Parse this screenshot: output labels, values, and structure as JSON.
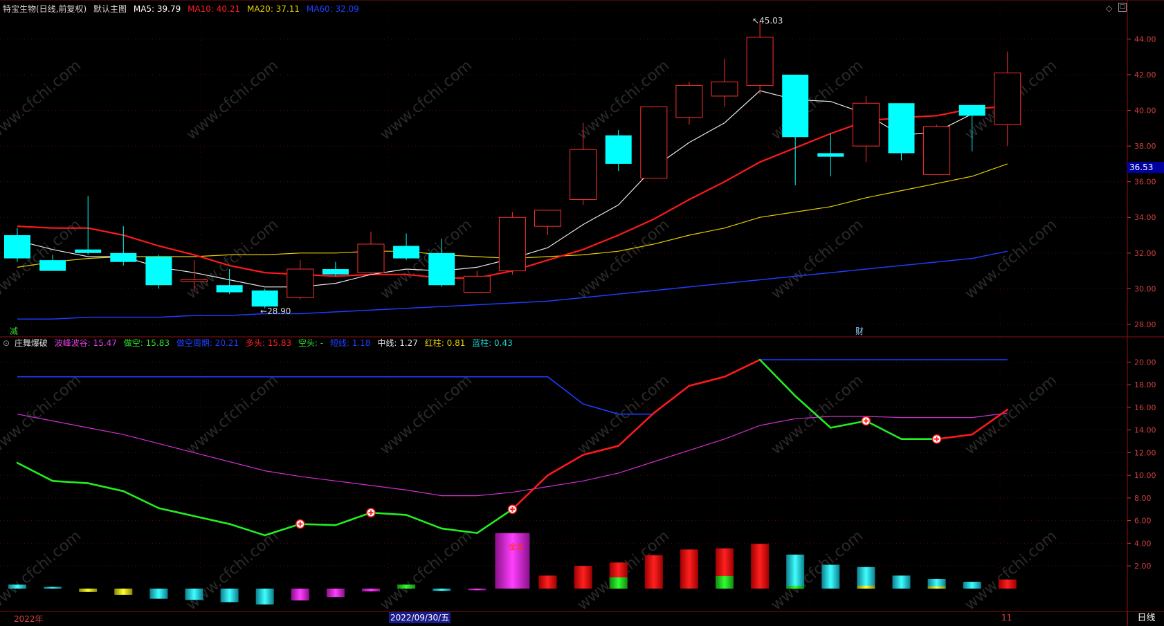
{
  "header_main": {
    "stock": "特宝生物(日线,前复权)",
    "chart_name": "默认主图",
    "ma": [
      {
        "label": "MA5: 39.79",
        "color": "#ffffff"
      },
      {
        "label": "MA10: 40.21",
        "color": "#ff2020"
      },
      {
        "label": "MA20: 37.11",
        "color": "#e6d000"
      },
      {
        "label": "MA60: 32.09",
        "color": "#2040ff"
      }
    ]
  },
  "header_ind": {
    "name": "庄舞爆破",
    "items": [
      {
        "label": "波峰波谷: 15.47",
        "color": "#e040e0"
      },
      {
        "label": "做空: 15.83",
        "color": "#30e030"
      },
      {
        "label": "做空周期: 20.21",
        "color": "#2040ff"
      },
      {
        "label": "多头: 15.83",
        "color": "#ff2020"
      },
      {
        "label": "空头: -",
        "color": "#30e030"
      },
      {
        "label": "短线: 1.18",
        "color": "#2040ff"
      },
      {
        "label": "中线: 1.27",
        "color": "#e0e0e0"
      },
      {
        "label": "红柱: 0.81",
        "color": "#e6d000"
      },
      {
        "label": "蓝柱: 0.43",
        "color": "#20d0d0"
      }
    ]
  },
  "price_box": "36.53",
  "period_label": "日线",
  "bottom_dates": [
    "2022年",
    "2022/09/30/五",
    "11"
  ],
  "markers": {
    "left": "减",
    "right": "财",
    "high": "45.03",
    "low": "28.90",
    "gold": "金金"
  },
  "watermark": "www.cfchi.com",
  "chart_data": [
    {
      "type": "candlestick",
      "title": "默认主图",
      "ylim": [
        27.3,
        45.8
      ],
      "yticks": [
        "28.00",
        "30.00",
        "32.00",
        "34.00",
        "36.00",
        "38.00",
        "40.00",
        "42.00",
        "44.00"
      ],
      "candles": [
        [
          33.0,
          33.4,
          31.5,
          31.7
        ],
        [
          31.6,
          31.9,
          31.1,
          31.0
        ],
        [
          32.2,
          35.2,
          31.9,
          32.0
        ],
        [
          32.0,
          33.5,
          31.3,
          31.5
        ],
        [
          31.8,
          31.9,
          30.0,
          30.2
        ],
        [
          30.4,
          31.6,
          29.9,
          30.5
        ],
        [
          30.2,
          31.1,
          29.7,
          29.8
        ],
        [
          29.9,
          30.0,
          28.9,
          29.0
        ],
        [
          29.5,
          31.6,
          29.4,
          31.1
        ],
        [
          31.1,
          31.5,
          30.7,
          30.8
        ],
        [
          30.9,
          33.2,
          30.8,
          32.5
        ],
        [
          32.4,
          33.1,
          31.6,
          31.7
        ],
        [
          32.0,
          32.8,
          30.1,
          30.2
        ],
        [
          29.8,
          31.0,
          29.8,
          30.7
        ],
        [
          31.0,
          34.3,
          30.8,
          34.0
        ],
        [
          33.5,
          34.2,
          33.0,
          34.4
        ],
        [
          35.0,
          39.3,
          34.7,
          37.8
        ],
        [
          38.6,
          38.9,
          36.6,
          37.0
        ],
        [
          36.2,
          40.2,
          36.2,
          40.2
        ],
        [
          39.6,
          41.6,
          39.2,
          41.4
        ],
        [
          40.8,
          42.9,
          40.2,
          41.6
        ],
        [
          41.4,
          45.0,
          40.9,
          44.1
        ],
        [
          42.0,
          41.4,
          35.8,
          38.5
        ],
        [
          37.6,
          38.7,
          36.3,
          37.4
        ],
        [
          38.0,
          40.8,
          37.1,
          40.4
        ],
        [
          40.4,
          40.4,
          37.2,
          37.6
        ],
        [
          36.4,
          39.2,
          36.4,
          39.1
        ],
        [
          40.3,
          40.3,
          37.7,
          39.7
        ],
        [
          39.2,
          43.3,
          38.0,
          42.1
        ]
      ],
      "ma5": [
        32.7,
        32.2,
        31.8,
        31.8,
        31.2,
        30.9,
        30.5,
        30.1,
        30.1,
        30.3,
        30.8,
        31.1,
        31.0,
        31.2,
        31.7,
        32.3,
        33.6,
        34.7,
        36.8,
        38.2,
        39.3,
        41.1,
        40.6,
        40.5,
        39.8,
        38.6,
        38.8,
        39.8
      ],
      "ma10": [
        33.5,
        33.4,
        33.4,
        33.0,
        32.4,
        31.9,
        31.3,
        30.9,
        30.8,
        30.7,
        30.8,
        30.8,
        30.6,
        30.6,
        31.0,
        31.6,
        32.2,
        33.0,
        33.9,
        35.0,
        36.0,
        37.1,
        37.9,
        38.7,
        39.4,
        39.6,
        39.7,
        40.1,
        40.2
      ],
      "ma20": [
        31.2,
        31.5,
        31.7,
        31.8,
        31.8,
        31.8,
        31.9,
        31.9,
        32.0,
        32.0,
        32.1,
        32.1,
        31.9,
        31.8,
        31.7,
        31.8,
        31.9,
        32.1,
        32.5,
        33.0,
        33.4,
        34.0,
        34.3,
        34.6,
        35.1,
        35.5,
        35.9,
        36.3,
        37.0
      ],
      "ma60": [
        28.3,
        28.3,
        28.4,
        28.4,
        28.4,
        28.5,
        28.5,
        28.6,
        28.6,
        28.7,
        28.8,
        28.9,
        29.0,
        29.1,
        29.2,
        29.3,
        29.5,
        29.7,
        29.9,
        30.1,
        30.3,
        30.5,
        30.7,
        30.9,
        31.1,
        31.3,
        31.5,
        31.7,
        32.1
      ]
    },
    {
      "type": "line",
      "title": "庄舞爆破",
      "ylim": [
        -1.9,
        21.0
      ],
      "yticks": [
        "2.00",
        "4.00",
        "6.00",
        "8.00",
        "10.00",
        "12.00",
        "14.00",
        "16.00",
        "18.00",
        "20.00"
      ],
      "series": [
        {
          "name": "做空",
          "color": "#30e030",
          "values": [
            11.1,
            9.5,
            9.3,
            8.6,
            7.1,
            6.4,
            5.7,
            4.7,
            5.7,
            5.6,
            6.7,
            6.5,
            5.3,
            4.9,
            7.0,
            10.0,
            11.8,
            12.6,
            15.5,
            17.9,
            18.7,
            20.2,
            17.0,
            14.2,
            14.8,
            13.2,
            13.2,
            13.6,
            15.8
          ]
        },
        {
          "name": "波峰波谷",
          "color": "#e040e0",
          "values": [
            15.4,
            14.8,
            14.2,
            13.6,
            12.8,
            12.0,
            11.2,
            10.4,
            9.9,
            9.5,
            9.1,
            8.7,
            8.2,
            8.2,
            8.5,
            9.0,
            9.5,
            10.2,
            11.2,
            12.2,
            13.2,
            14.4,
            15.0,
            15.2,
            15.2,
            15.1,
            15.1,
            15.1,
            15.5
          ]
        },
        {
          "name": "做空周期",
          "color": "#2040ff",
          "values": [
            18.7,
            18.7,
            18.7,
            18.7,
            18.7,
            18.7,
            18.7,
            18.7,
            18.7,
            18.7,
            18.7,
            18.7,
            18.7,
            18.7,
            18.7,
            18.7,
            16.3,
            15.4,
            15.4,
            null,
            null,
            20.2,
            20.2,
            20.2,
            20.2,
            20.2,
            20.2,
            20.2,
            20.2
          ]
        }
      ],
      "bars": [
        [
          0.35,
          "cyan"
        ],
        [
          0.15,
          "cyan"
        ],
        [
          -0.3,
          "yellow"
        ],
        [
          -0.55,
          "yellow"
        ],
        [
          -0.9,
          "cyan"
        ],
        [
          -1.0,
          "cyan"
        ],
        [
          -1.2,
          "cyan"
        ],
        [
          -1.4,
          "cyan"
        ],
        [
          -1.05,
          "magenta"
        ],
        [
          -0.75,
          "magenta"
        ],
        [
          -0.25,
          "magenta"
        ],
        [
          0.35,
          "green"
        ],
        [
          -0.2,
          "cyan"
        ],
        [
          -0.15,
          "magenta"
        ],
        [
          4.9,
          "magenta"
        ],
        [
          1.15,
          "red"
        ],
        [
          2.0,
          "red"
        ],
        [
          2.3,
          "red"
        ],
        [
          2.95,
          "red"
        ],
        [
          3.45,
          "red"
        ],
        [
          3.55,
          "red"
        ],
        [
          3.95,
          "red"
        ],
        [
          3.0,
          "cyan"
        ],
        [
          2.1,
          "cyan"
        ],
        [
          1.9,
          "cyan"
        ],
        [
          1.15,
          "cyan"
        ],
        [
          0.85,
          "cyan"
        ],
        [
          0.6,
          "cyan"
        ],
        [
          0.8,
          "red"
        ]
      ],
      "signals": [
        8,
        10,
        14,
        24,
        26
      ]
    }
  ]
}
